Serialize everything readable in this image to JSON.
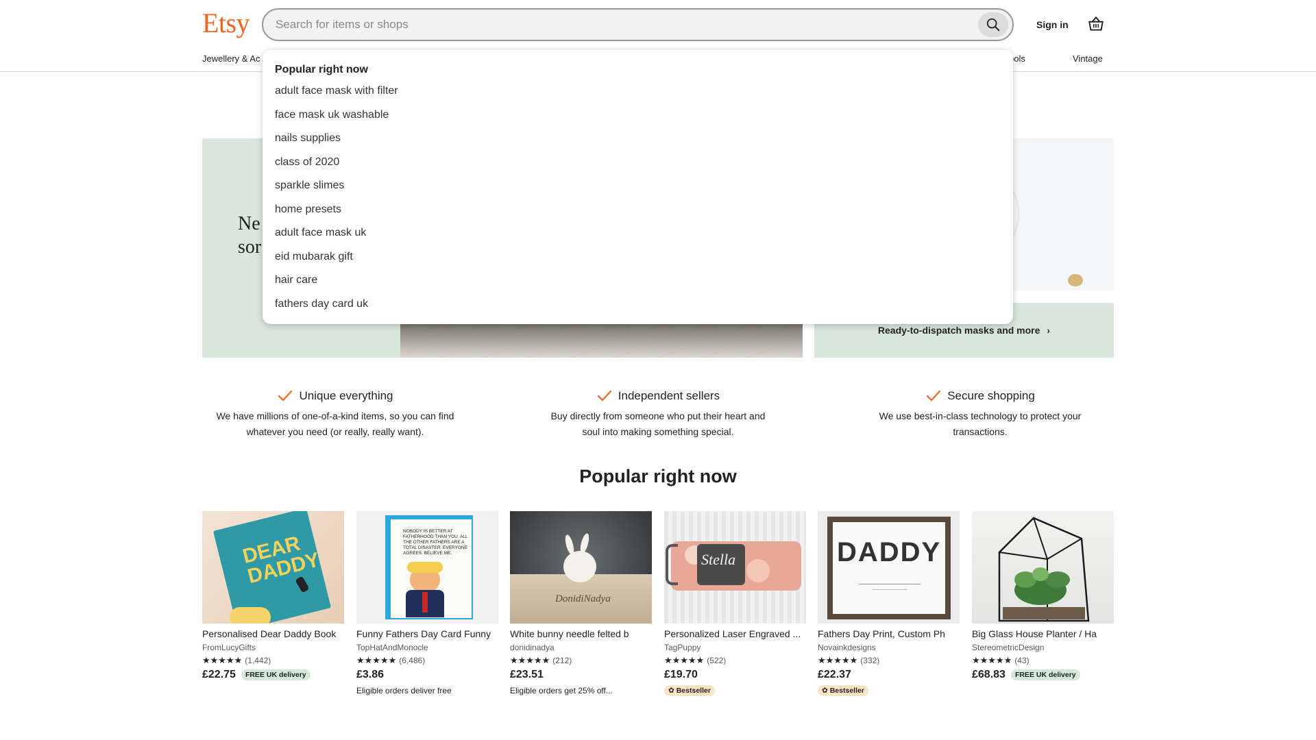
{
  "header": {
    "logo": "Etsy",
    "search_placeholder": "Search for items or shops",
    "signin_label": "Sign in",
    "categories": {
      "left": "Jewellery & Ac",
      "tools": "ools",
      "vintage": "Vintage"
    }
  },
  "dropdown": {
    "title": "Popular right now",
    "items": [
      "adult face mask with filter",
      "face mask uk washable",
      "nails supplies",
      "class of 2020",
      "sparkle slimes",
      "home presets",
      "adult face mask uk",
      "eid mubarak gift",
      "hair care",
      "fathers day card uk"
    ]
  },
  "hero": {
    "text_line1": "Ne",
    "text_line2": "sor",
    "dispatch_label": "Ready-to-dispatch masks and more",
    "dispatch_chevron": "›"
  },
  "value_props": [
    {
      "title": "Unique everything",
      "desc": "We have millions of one-of-a-kind items, so you can find whatever you need (or really, really want)."
    },
    {
      "title": "Independent sellers",
      "desc": "Buy directly from someone who put their heart and soul into making something special."
    },
    {
      "title": "Secure shopping",
      "desc": "We use best-in-class technology to protect your transactions."
    }
  ],
  "popular": {
    "title": "Popular right now",
    "products": [
      {
        "title": "Personalised Dear Daddy Book",
        "shop": "FromLucyGifts",
        "stars": "★★★★★",
        "reviews": "(1,442)",
        "price": "£22.75",
        "free_delivery": "FREE UK delivery",
        "note": "",
        "bestseller": "",
        "img_text": "DEAR DADDY"
      },
      {
        "title": "Funny Fathers Day Card Funny",
        "shop": "TopHatAndMonocle",
        "stars": "★★★★★",
        "reviews": "(6,486)",
        "price": "£3.86",
        "free_delivery": "",
        "note": "Eligible orders deliver free",
        "bestseller": "",
        "img_text": "NOBODY IS BETTER AT FATHERHOOD THAN YOU. ALL THE OTHER FATHERS ARE A TOTAL DISASTER. EVERYONE AGREES. BELIEVE ME."
      },
      {
        "title": "White bunny needle felted b",
        "shop": "donidinadya",
        "stars": "★★★★★",
        "reviews": "(212)",
        "price": "£23.51",
        "free_delivery": "",
        "note": "Eligible orders get 25% off...",
        "bestseller": "",
        "img_text": "DonidiNadya"
      },
      {
        "title": "Personalized Laser Engraved ...",
        "shop": "TagPuppy",
        "stars": "★★★★★",
        "reviews": "(522)",
        "price": "£19.70",
        "free_delivery": "",
        "note": "",
        "bestseller": "Bestseller",
        "img_text": "Stella"
      },
      {
        "title": "Fathers Day Print, Custom Ph",
        "shop": "Novainkdesigns",
        "stars": "★★★★★",
        "reviews": "(332)",
        "price": "£22.37",
        "free_delivery": "",
        "note": "",
        "bestseller": "Bestseller",
        "img_text": "DADDY"
      },
      {
        "title": "Big Glass House Planter / Ha",
        "shop": "StereometricDesign",
        "stars": "★★★★★",
        "reviews": "(43)",
        "price": "£68.83",
        "free_delivery": "FREE UK delivery",
        "note": "",
        "bestseller": "",
        "img_text": ""
      }
    ]
  },
  "colors": {
    "brand": "#f1641e",
    "hero_green": "#d8e6dc",
    "free_badge": "#d4e9d7",
    "bestseller_badge": "#fbe3c3"
  }
}
